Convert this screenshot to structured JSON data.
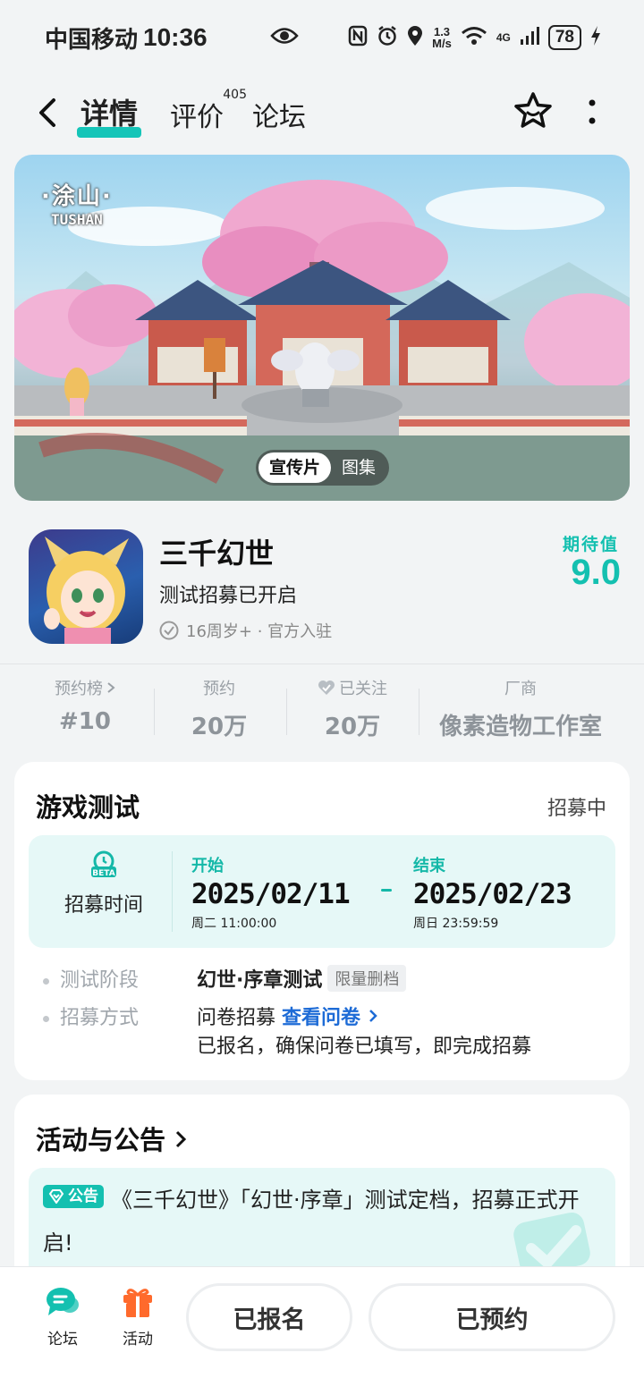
{
  "status_bar": {
    "carrier": "中国移动",
    "time": "10:36",
    "speed_value": "1.3",
    "speed_unit": "M/s",
    "network": "4G",
    "battery": "78"
  },
  "nav": {
    "tabs": [
      {
        "label": "详情",
        "active": true
      },
      {
        "label": "评价",
        "count": "405"
      },
      {
        "label": "论坛"
      }
    ]
  },
  "banner": {
    "logo_zh": "·涂山·",
    "logo_en": "TUSHAN",
    "media_options": [
      "宣传片",
      "图集"
    ],
    "active_media": "宣传片"
  },
  "game": {
    "title": "三千幻世",
    "status": "测试招募已开启",
    "meta": "16周岁+ · 官方入驻",
    "expect_label": "期待值",
    "expect_score": "9.0"
  },
  "stats": [
    {
      "label": "预约榜",
      "value": "#10"
    },
    {
      "label": "预约",
      "value": "20万"
    },
    {
      "label": "已关注",
      "value": "20万"
    },
    {
      "label": "厂商",
      "value": "像素造物工作室"
    }
  ],
  "test": {
    "title": "游戏测试",
    "badge": "招募中",
    "beta_label": "BETA",
    "recruit_label": "招募时间",
    "start_tag": "开始",
    "start_date": "2025/02/11",
    "start_sub": "周二  11:00:00",
    "end_tag": "结束",
    "end_date": "2025/02/23",
    "end_sub": "周日  23:59:59",
    "phase_key": "测试阶段",
    "phase_value": "幻世·序章测试",
    "phase_tag": "限量删档",
    "method_key": "招募方式",
    "method_value": "问卷招募",
    "method_link": "查看问卷",
    "method_note": "已报名，确保问卷已填写，即完成招募"
  },
  "news": {
    "title": "活动与公告",
    "tag": "公告",
    "headline": "《三千幻世》「幻世·序章」测试定档，招募正式开启!"
  },
  "bottom": {
    "forum_label": "论坛",
    "activity_label": "活动",
    "signed_button": "已报名",
    "reserved_button": "已预约"
  },
  "colors": {
    "accent": "#14c0b0",
    "link": "#1d6bd6",
    "activity_icon": "#ff6a2c"
  }
}
